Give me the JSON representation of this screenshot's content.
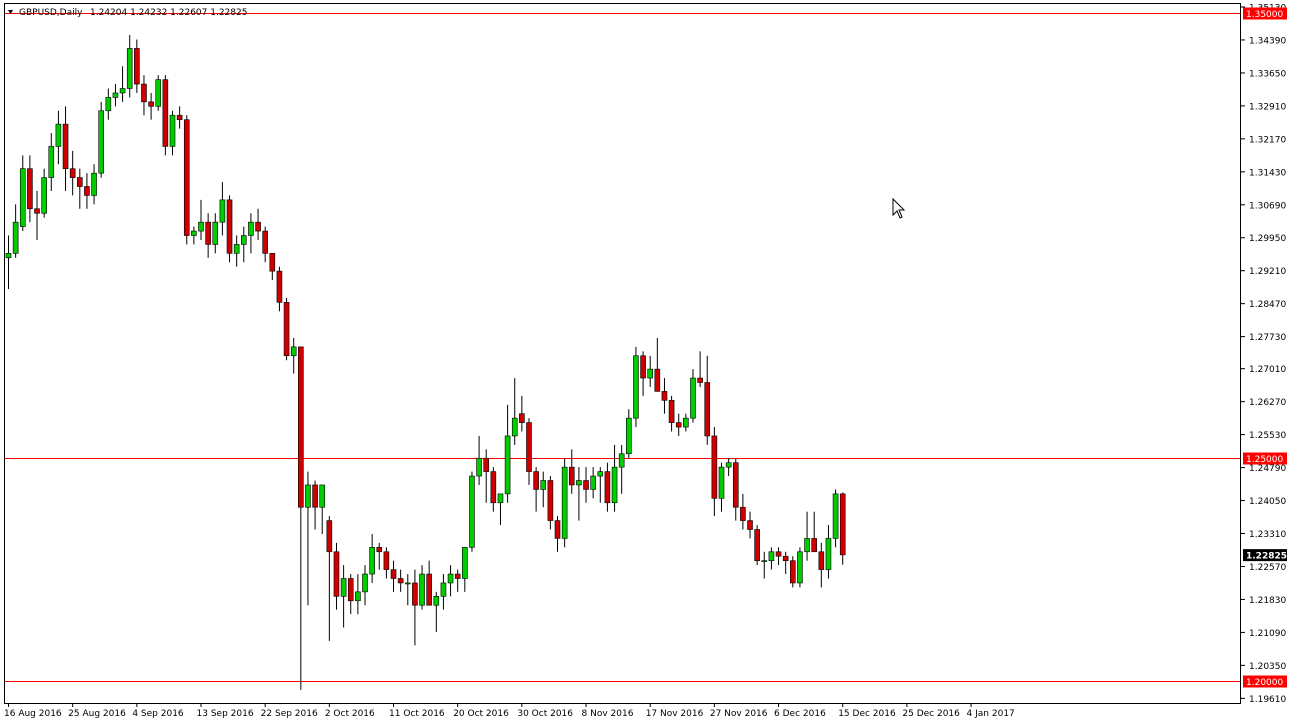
{
  "header": {
    "symbol": "GBPUSD,Daily",
    "ohlc": "1.24204 1.24232 1.22607 1.22825"
  },
  "colors": {
    "bull": "#00cc00",
    "bear": "#cc0000",
    "hline": "#ff0000",
    "frame": "#000000",
    "current_price_bg": "#000000"
  },
  "chart_data": {
    "type": "candlestick",
    "title": "GBPUSD,Daily",
    "ylim": [
      1.1955,
      1.3513
    ],
    "y_ticks": [
      "1.35130",
      "1.34390",
      "1.33650",
      "1.32910",
      "1.32170",
      "1.31430",
      "1.30690",
      "1.29950",
      "1.29210",
      "1.28470",
      "1.27730",
      "1.27010",
      "1.26270",
      "1.25530",
      "1.24790",
      "1.24050",
      "1.23310",
      "1.22570",
      "1.21830",
      "1.21090",
      "1.20350",
      "1.19610"
    ],
    "x_labels": [
      "16 Aug 2016",
      "25 Aug 2016",
      "4 Sep 2016",
      "13 Sep 2016",
      "22 Sep 2016",
      "2 Oct 2016",
      "11 Oct 2016",
      "20 Oct 2016",
      "30 Oct 2016",
      "8 Nov 2016",
      "17 Nov 2016",
      "27 Nov 2016",
      "6 Dec 2016",
      "15 Dec 2016",
      "25 Dec 2016",
      "4 Jan 2017"
    ],
    "x_label_bar_index": [
      0,
      9,
      18,
      27,
      36,
      45,
      54,
      63,
      72,
      81,
      90,
      99,
      108,
      117,
      126,
      135
    ],
    "horizontal_lines": [
      {
        "price": 1.35,
        "label": "1.35000"
      },
      {
        "price": 1.25,
        "label": "1.25000"
      },
      {
        "price": 1.2,
        "label": "1.20000"
      }
    ],
    "current_price": "1.22825",
    "candles": [
      [
        1.295,
        1.3,
        1.288,
        1.296
      ],
      [
        1.296,
        1.307,
        1.295,
        1.303
      ],
      [
        1.302,
        1.318,
        1.301,
        1.315
      ],
      [
        1.315,
        1.318,
        1.303,
        1.306
      ],
      [
        1.306,
        1.31,
        1.299,
        1.305
      ],
      [
        1.305,
        1.315,
        1.304,
        1.313
      ],
      [
        1.313,
        1.323,
        1.31,
        1.32
      ],
      [
        1.32,
        1.328,
        1.316,
        1.325
      ],
      [
        1.325,
        1.329,
        1.31,
        1.315
      ],
      [
        1.315,
        1.319,
        1.309,
        1.313
      ],
      [
        1.313,
        1.315,
        1.306,
        1.311
      ],
      [
        1.311,
        1.314,
        1.306,
        1.309
      ],
      [
        1.309,
        1.316,
        1.307,
        1.314
      ],
      [
        1.314,
        1.33,
        1.313,
        1.328
      ],
      [
        1.328,
        1.333,
        1.326,
        1.331
      ],
      [
        1.331,
        1.334,
        1.329,
        1.332
      ],
      [
        1.332,
        1.338,
        1.33,
        1.333
      ],
      [
        1.333,
        1.345,
        1.331,
        1.342
      ],
      [
        1.342,
        1.344,
        1.332,
        1.334
      ],
      [
        1.334,
        1.336,
        1.327,
        1.33
      ],
      [
        1.33,
        1.332,
        1.326,
        1.329
      ],
      [
        1.329,
        1.336,
        1.328,
        1.335
      ],
      [
        1.335,
        1.336,
        1.318,
        1.32
      ],
      [
        1.32,
        1.328,
        1.318,
        1.327
      ],
      [
        1.327,
        1.329,
        1.324,
        1.326
      ],
      [
        1.326,
        1.327,
        1.298,
        1.3
      ],
      [
        1.3,
        1.302,
        1.298,
        1.301
      ],
      [
        1.301,
        1.308,
        1.299,
        1.303
      ],
      [
        1.303,
        1.305,
        1.295,
        1.298
      ],
      [
        1.298,
        1.305,
        1.296,
        1.303
      ],
      [
        1.303,
        1.312,
        1.3,
        1.308
      ],
      [
        1.308,
        1.309,
        1.294,
        1.296
      ],
      [
        1.296,
        1.3,
        1.293,
        1.298
      ],
      [
        1.298,
        1.302,
        1.294,
        1.3
      ],
      [
        1.3,
        1.305,
        1.296,
        1.303
      ],
      [
        1.303,
        1.306,
        1.299,
        1.301
      ],
      [
        1.301,
        1.302,
        1.294,
        1.296
      ],
      [
        1.296,
        1.296,
        1.29,
        1.292
      ],
      [
        1.292,
        1.293,
        1.283,
        1.285
      ],
      [
        1.285,
        1.286,
        1.272,
        1.273
      ],
      [
        1.273,
        1.277,
        1.269,
        1.275
      ],
      [
        1.275,
        1.275,
        1.198,
        1.239
      ],
      [
        1.239,
        1.247,
        1.217,
        1.244
      ],
      [
        1.244,
        1.245,
        1.234,
        1.239
      ],
      [
        1.239,
        1.244,
        1.233,
        1.244
      ],
      [
        1.236,
        1.237,
        1.209,
        1.229
      ],
      [
        1.229,
        1.231,
        1.216,
        1.219
      ],
      [
        1.219,
        1.226,
        1.212,
        1.223
      ],
      [
        1.223,
        1.224,
        1.215,
        1.218
      ],
      [
        1.218,
        1.224,
        1.215,
        1.22
      ],
      [
        1.22,
        1.226,
        1.217,
        1.224
      ],
      [
        1.224,
        1.233,
        1.222,
        1.23
      ],
      [
        1.23,
        1.231,
        1.225,
        1.229
      ],
      [
        1.229,
        1.23,
        1.223,
        1.225
      ],
      [
        1.225,
        1.227,
        1.22,
        1.223
      ],
      [
        1.223,
        1.225,
        1.22,
        1.222
      ],
      [
        1.222,
        1.224,
        1.217,
        1.222
      ],
      [
        1.222,
        1.225,
        1.208,
        1.217
      ],
      [
        1.217,
        1.226,
        1.216,
        1.224
      ],
      [
        1.224,
        1.227,
        1.218,
        1.217
      ],
      [
        1.217,
        1.22,
        1.211,
        1.219
      ],
      [
        1.219,
        1.224,
        1.216,
        1.222
      ],
      [
        1.222,
        1.226,
        1.219,
        1.224
      ],
      [
        1.224,
        1.225,
        1.22,
        1.223
      ],
      [
        1.223,
        1.23,
        1.22,
        1.23
      ],
      [
        1.23,
        1.247,
        1.229,
        1.246
      ],
      [
        1.246,
        1.255,
        1.244,
        1.25
      ],
      [
        1.25,
        1.252,
        1.24,
        1.247
      ],
      [
        1.247,
        1.248,
        1.238,
        1.24
      ],
      [
        1.24,
        1.242,
        1.235,
        1.242
      ],
      [
        1.242,
        1.262,
        1.24,
        1.255
      ],
      [
        1.255,
        1.268,
        1.253,
        1.259
      ],
      [
        1.26,
        1.264,
        1.256,
        1.258
      ],
      [
        1.258,
        1.259,
        1.244,
        1.247
      ],
      [
        1.247,
        1.248,
        1.238,
        1.243
      ],
      [
        1.243,
        1.247,
        1.239,
        1.245
      ],
      [
        1.245,
        1.246,
        1.234,
        1.236
      ],
      [
        1.236,
        1.237,
        1.229,
        1.232
      ],
      [
        1.232,
        1.25,
        1.23,
        1.248
      ],
      [
        1.248,
        1.252,
        1.242,
        1.244
      ],
      [
        1.244,
        1.248,
        1.236,
        1.245
      ],
      [
        1.245,
        1.248,
        1.24,
        1.243
      ],
      [
        1.243,
        1.248,
        1.241,
        1.246
      ],
      [
        1.246,
        1.248,
        1.24,
        1.247
      ],
      [
        1.247,
        1.249,
        1.238,
        1.24
      ],
      [
        1.24,
        1.253,
        1.238,
        1.248
      ],
      [
        1.248,
        1.253,
        1.242,
        1.251
      ],
      [
        1.251,
        1.261,
        1.25,
        1.259
      ],
      [
        1.259,
        1.275,
        1.257,
        1.273
      ],
      [
        1.273,
        1.274,
        1.264,
        1.268
      ],
      [
        1.268,
        1.273,
        1.266,
        1.27
      ],
      [
        1.27,
        1.277,
        1.266,
        1.265
      ],
      [
        1.265,
        1.268,
        1.26,
        1.263
      ],
      [
        1.263,
        1.264,
        1.256,
        1.258
      ],
      [
        1.258,
        1.26,
        1.255,
        1.257
      ],
      [
        1.257,
        1.26,
        1.256,
        1.259
      ],
      [
        1.259,
        1.27,
        1.258,
        1.268
      ],
      [
        1.268,
        1.274,
        1.266,
        1.267
      ],
      [
        1.267,
        1.273,
        1.253,
        1.255
      ],
      [
        1.255,
        1.257,
        1.237,
        1.241
      ],
      [
        1.241,
        1.249,
        1.238,
        1.248
      ],
      [
        1.248,
        1.25,
        1.246,
        1.249
      ],
      [
        1.249,
        1.25,
        1.236,
        1.239
      ],
      [
        1.239,
        1.242,
        1.234,
        1.236
      ],
      [
        1.236,
        1.238,
        1.232,
        1.234
      ],
      [
        1.234,
        1.235,
        1.226,
        1.227
      ],
      [
        1.227,
        1.229,
        1.223,
        1.227
      ],
      [
        1.227,
        1.23,
        1.225,
        1.229
      ],
      [
        1.229,
        1.23,
        1.226,
        1.228
      ],
      [
        1.228,
        1.229,
        1.224,
        1.227
      ],
      [
        1.227,
        1.228,
        1.221,
        1.222
      ],
      [
        1.222,
        1.23,
        1.221,
        1.229
      ],
      [
        1.229,
        1.238,
        1.227,
        1.232
      ],
      [
        1.232,
        1.238,
        1.23,
        1.229
      ],
      [
        1.229,
        1.231,
        1.221,
        1.225
      ],
      [
        1.225,
        1.235,
        1.223,
        1.232
      ],
      [
        1.232,
        1.243,
        1.23,
        1.242
      ],
      [
        1.242,
        1.2423,
        1.2261,
        1.2283
      ]
    ]
  }
}
